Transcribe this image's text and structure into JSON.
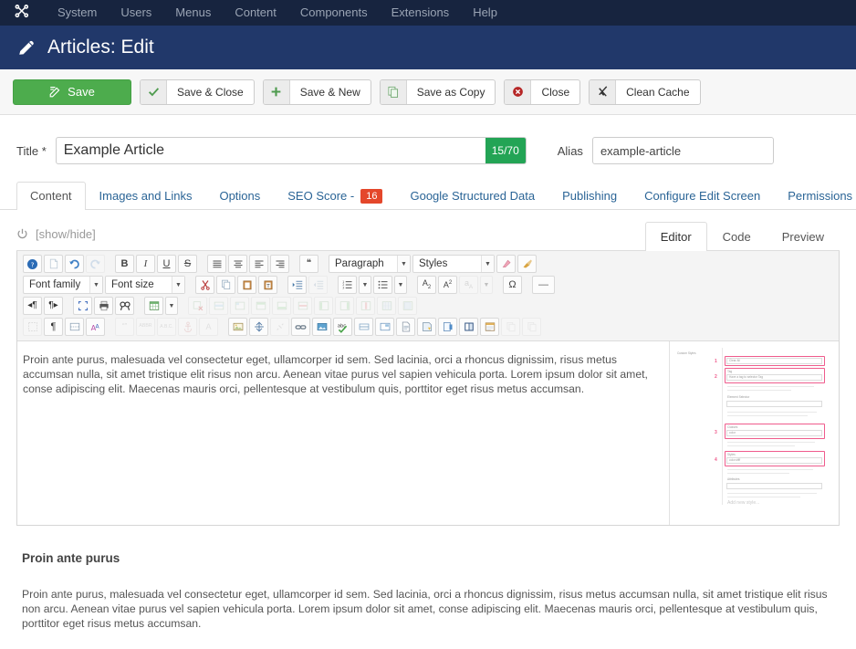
{
  "topnav": {
    "logo": "joomla-logo",
    "items": [
      {
        "label": "System"
      },
      {
        "label": "Users"
      },
      {
        "label": "Menus"
      },
      {
        "label": "Content"
      },
      {
        "label": "Components"
      },
      {
        "label": "Extensions"
      },
      {
        "label": "Help"
      }
    ]
  },
  "header": {
    "icon": "pencil-icon",
    "title": "Articles: Edit"
  },
  "toolbar": {
    "save": {
      "label": "Save",
      "icon": "save-pencil-icon"
    },
    "save_close": {
      "label": "Save & Close",
      "icon": "check-icon"
    },
    "save_new": {
      "label": "Save & New",
      "icon": "plus-icon"
    },
    "save_copy": {
      "label": "Save as Copy",
      "icon": "copy-icon"
    },
    "close": {
      "label": "Close",
      "icon": "close-circle-icon"
    },
    "clean_cache": {
      "label": "Clean Cache",
      "icon": "broom-icon"
    }
  },
  "form": {
    "title_label": "Title *",
    "title_value": "Example Article",
    "title_placeholder": "Title",
    "char_count": "15/70",
    "alias_label": "Alias",
    "alias_value": "example-article",
    "alias_placeholder": "example-article"
  },
  "tabs": [
    {
      "label": "Content",
      "active": true
    },
    {
      "label": "Images and Links",
      "active": false
    },
    {
      "label": "Options",
      "active": false
    },
    {
      "label": "SEO Score - ",
      "badge": "16",
      "active": false
    },
    {
      "label": "Google Structured Data",
      "active": false
    },
    {
      "label": "Publishing",
      "active": false
    },
    {
      "label": "Configure Edit Screen",
      "active": false
    },
    {
      "label": "Permissions",
      "active": false
    }
  ],
  "editor": {
    "toggle_label": "[show/hide]",
    "toggle_icon": "power-icon",
    "modes": [
      {
        "label": "Editor",
        "active": true
      },
      {
        "label": "Code",
        "active": false
      },
      {
        "label": "Preview",
        "active": false
      }
    ],
    "toolbar_row1": {
      "buttons": [
        {
          "name": "help-icon",
          "glyph": "?"
        },
        {
          "name": "new-document-icon",
          "glyph": "⬜"
        },
        {
          "name": "undo-icon",
          "glyph": "↶"
        },
        {
          "name": "redo-icon",
          "glyph": "↷",
          "disabled": true
        },
        {
          "name": "bold-icon",
          "glyph": "B"
        },
        {
          "name": "italic-icon",
          "glyph": "I"
        },
        {
          "name": "underline-icon",
          "glyph": "U"
        },
        {
          "name": "strikethrough-icon",
          "glyph": "S"
        },
        {
          "name": "align-justify-icon",
          "glyph": "≡"
        },
        {
          "name": "align-center-icon",
          "glyph": "≡"
        },
        {
          "name": "align-left-icon",
          "glyph": "≡"
        },
        {
          "name": "align-right-icon",
          "glyph": "≡"
        },
        {
          "name": "blockquote-icon",
          "glyph": "❝"
        }
      ],
      "paragraph_select": "Paragraph",
      "styles_select": "Styles",
      "extra": [
        {
          "name": "text-color-icon",
          "glyph": "✎"
        },
        {
          "name": "paint-brush-icon",
          "glyph": "🖌"
        }
      ]
    },
    "toolbar_row2": {
      "font_family_select": "Font family",
      "font_size_select": "Font size",
      "buttons": [
        {
          "name": "cut-icon",
          "glyph": "✂"
        },
        {
          "name": "copy-icon",
          "glyph": "❐"
        },
        {
          "name": "paste-icon",
          "glyph": "📋"
        },
        {
          "name": "paste-as-text-icon",
          "glyph": "T"
        },
        {
          "name": "indent-increase-icon",
          "glyph": "⇥"
        },
        {
          "name": "indent-decrease-icon",
          "glyph": "⇤",
          "disabled": true
        },
        {
          "name": "numbered-list-icon",
          "glyph": "≔"
        },
        {
          "name": "bullet-list-icon",
          "glyph": "•"
        },
        {
          "name": "subscript-icon",
          "glyph": "A₂"
        },
        {
          "name": "superscript-icon",
          "glyph": "A²"
        },
        {
          "name": "remove-format-icon",
          "glyph": "a",
          "disabled": true
        },
        {
          "name": "special-character-icon",
          "glyph": "Ω"
        },
        {
          "name": "horizontal-rule-icon",
          "glyph": "—"
        }
      ]
    },
    "toolbar_row3": {
      "buttons": [
        {
          "name": "ltr-direction-icon",
          "glyph": "¶"
        },
        {
          "name": "rtl-direction-icon",
          "glyph": "¶"
        },
        {
          "name": "fullscreen-icon",
          "glyph": "⛶"
        },
        {
          "name": "print-icon",
          "glyph": "🖨"
        },
        {
          "name": "search-replace-icon",
          "glyph": "🔍"
        },
        {
          "name": "insert-table-icon",
          "glyph": "▦"
        },
        {
          "name": "delete-table-icon",
          "glyph": "▦",
          "disabled": true
        },
        {
          "name": "table-row-properties-icon",
          "glyph": "▤",
          "disabled": true
        },
        {
          "name": "table-cell-properties-icon",
          "glyph": "▥",
          "disabled": true
        },
        {
          "name": "insert-row-before-icon",
          "glyph": "▤",
          "disabled": true
        },
        {
          "name": "insert-row-after-icon",
          "glyph": "▤",
          "disabled": true
        },
        {
          "name": "delete-row-icon",
          "glyph": "▤",
          "disabled": true
        },
        {
          "name": "insert-column-before-icon",
          "glyph": "▥",
          "disabled": true
        },
        {
          "name": "insert-column-after-icon",
          "glyph": "▥",
          "disabled": true
        },
        {
          "name": "delete-column-icon",
          "glyph": "▥",
          "disabled": true
        },
        {
          "name": "split-cells-icon",
          "glyph": "▦",
          "disabled": true
        },
        {
          "name": "merge-cells-icon",
          "glyph": "▧",
          "disabled": true
        }
      ]
    },
    "toolbar_row4": {
      "buttons": [
        {
          "name": "select-all-icon",
          "glyph": "⬚",
          "disabled": true
        },
        {
          "name": "show-blocks-icon",
          "glyph": "¶"
        },
        {
          "name": "page-break-icon",
          "glyph": "☰"
        },
        {
          "name": "spellcheck-language-icon",
          "glyph": "A"
        },
        {
          "name": "quote-icon",
          "glyph": "“”",
          "disabled": true
        },
        {
          "name": "abbreviation-icon",
          "glyph": "ABBR",
          "disabled": true
        },
        {
          "name": "acronym-icon",
          "glyph": "A.B.C.",
          "disabled": true
        },
        {
          "name": "anchor-icon",
          "glyph": "⚓",
          "disabled": true
        },
        {
          "name": "delete-style-icon",
          "glyph": "A",
          "disabled": true
        },
        {
          "name": "insert-image-icon",
          "glyph": "🖼"
        },
        {
          "name": "insert-media-icon",
          "glyph": "⚓"
        },
        {
          "name": "unlink-icon",
          "glyph": "⛓",
          "disabled": true
        },
        {
          "name": "insert-link-icon",
          "glyph": "🔗"
        },
        {
          "name": "insert-picture-icon",
          "glyph": "🏞"
        },
        {
          "name": "spellchecker-icon",
          "glyph": "abc"
        },
        {
          "name": "insert-horizontal-rule-icon",
          "glyph": "▭"
        },
        {
          "name": "insert-layer-icon",
          "glyph": "▧"
        },
        {
          "name": "article-icon",
          "glyph": "📄"
        },
        {
          "name": "read-more-icon",
          "glyph": "📑"
        },
        {
          "name": "page-break-insert-icon",
          "glyph": "📗"
        },
        {
          "name": "module-icon",
          "glyph": "▤"
        },
        {
          "name": "toggle-editor-icon",
          "glyph": "📅"
        },
        {
          "name": "insert-field-icon",
          "glyph": "❐",
          "disabled": true
        },
        {
          "name": "insert-contact-icon",
          "glyph": "❐",
          "disabled": true
        }
      ]
    },
    "content": {
      "paragraph": "Proin ante purus, malesuada vel consectetur eget, ullamcorper id sem. Sed lacinia, orci a rhoncus dignissim, risus metus accumsan nulla, sit amet tristique elit risus non arcu. Aenean vitae purus vel sapien vehicula porta. Lorem ipsum dolor sit amet, conse adipiscing elit. Maecenas mauris orci, pellentesque at vestibulum quis, porttitor eget risus metus accumsan."
    },
    "thumbnail": {
      "name": "custom-styles-screenshot",
      "panel_label": "Custom Styles",
      "fields": [
        {
          "num": "1",
          "label": "",
          "value": "Clear All"
        },
        {
          "num": "2",
          "label": "Tag",
          "value": "Have a tag to selector Tag"
        },
        {
          "num": "3",
          "label": "Classes",
          "value": "color"
        },
        {
          "num": "4",
          "label": "Styles",
          "value": "color:#fff"
        }
      ],
      "plain_fields": [
        {
          "label": "Element Selector",
          "value": ""
        },
        {
          "label": "Attributes",
          "value": ""
        }
      ],
      "footer": "Add new style..."
    }
  },
  "lower": {
    "heading": "Proin ante purus",
    "paragraph": "Proin ante purus, malesuada vel consectetur eget, ullamcorper id sem. Sed lacinia, orci a rhoncus dignissim, risus metus accumsan nulla, sit amet tristique elit risus non arcu. Aenean vitae purus vel sapien vehicula porta. Lorem ipsum dolor sit amet, conse adipiscing elit. Maecenas mauris orci, pellentesque at vestibulum quis, porttitor eget risus metus accumsan."
  },
  "colors": {
    "topbar": "#17243f",
    "titlebar": "#21386a",
    "save_green": "#4dac4d",
    "badge_green": "#23a455",
    "seo_red": "#e4472b",
    "link_blue": "#2a6496"
  }
}
